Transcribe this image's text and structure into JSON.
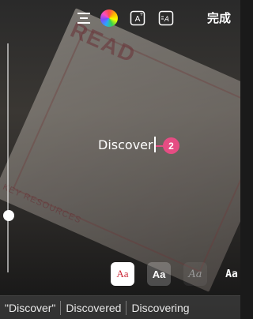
{
  "toolbar": {
    "align_icon": "align-center-icon",
    "color_icon": "color-wheel-icon",
    "text_style_icon": "text-style-icon",
    "animate_icon": "text-animate-icon",
    "done_label": "完成"
  },
  "editor": {
    "text": "Discover",
    "callout_number": "2"
  },
  "fonts": [
    {
      "label": "Aa",
      "state": "selected"
    },
    {
      "label": "Aa",
      "state": "bold"
    },
    {
      "label": "Aa",
      "state": "script"
    },
    {
      "label": "Aa",
      "state": "mono"
    }
  ],
  "suggestions": [
    "\"Discover\"",
    "Discovered",
    "Discovering"
  ],
  "colors": {
    "callout": "#e54d83",
    "selected_font_text": "#cc2a39"
  },
  "background_photo": {
    "printed_text": "READ",
    "printed_text_small": "KEY RESOURCES"
  }
}
